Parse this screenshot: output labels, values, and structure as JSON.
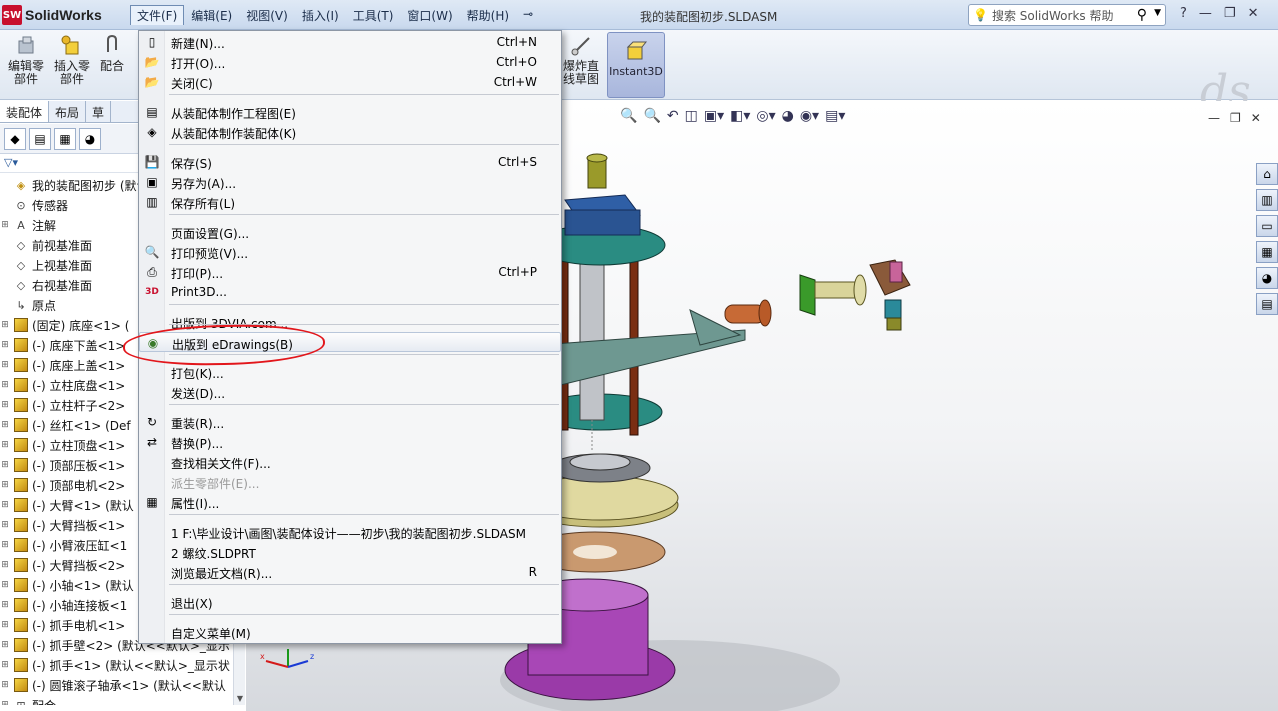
{
  "app": {
    "name": "SolidWorks",
    "logo_mark": "SW",
    "document_title": "我的装配图初步.SLDASM"
  },
  "menubar": [
    "文件(F)",
    "编辑(E)",
    "视图(V)",
    "插入(I)",
    "工具(T)",
    "窗口(W)",
    "帮助(H)"
  ],
  "search": {
    "placeholder": "搜索 SolidWorks 帮助"
  },
  "toolbar": {
    "edit_part": "编辑零\n部件",
    "insert_part": "插入零\n部件",
    "mate": "配合",
    "explode_line": "爆炸直\n线草图",
    "instant3d": "Instant3D"
  },
  "left_tabs": [
    "装配体",
    "布局",
    "草"
  ],
  "tree": [
    {
      "label": "我的装配图初步 (默认",
      "icon": "assembly-icon",
      "exp": ""
    },
    {
      "label": "传感器",
      "icon": "sensor-icon",
      "exp": ""
    },
    {
      "label": "注解",
      "icon": "annotation-icon",
      "exp": "⊞"
    },
    {
      "label": "前视基准面",
      "icon": "plane-icon",
      "exp": ""
    },
    {
      "label": "上视基准面",
      "icon": "plane-icon",
      "exp": ""
    },
    {
      "label": "右视基准面",
      "icon": "plane-icon",
      "exp": ""
    },
    {
      "label": "原点",
      "icon": "origin-icon",
      "exp": ""
    },
    {
      "label": "(固定) 底座<1> (",
      "icon": "part-icon",
      "exp": "⊞"
    },
    {
      "label": "(-) 底座下盖<1>",
      "icon": "part-icon",
      "exp": "⊞"
    },
    {
      "label": "(-) 底座上盖<1>",
      "icon": "part-icon",
      "exp": "⊞"
    },
    {
      "label": "(-) 立柱底盘<1>",
      "icon": "part-icon",
      "exp": "⊞"
    },
    {
      "label": "(-) 立柱杆子<2>",
      "icon": "part-icon",
      "exp": "⊞"
    },
    {
      "label": "(-) 丝杠<1> (Def",
      "icon": "part-icon",
      "exp": "⊞"
    },
    {
      "label": "(-) 立柱顶盘<1>",
      "icon": "part-icon",
      "exp": "⊞"
    },
    {
      "label": "(-) 顶部压板<1>",
      "icon": "part-icon",
      "exp": "⊞"
    },
    {
      "label": "(-) 顶部电机<2>",
      "icon": "part-icon",
      "exp": "⊞"
    },
    {
      "label": "(-) 大臂<1> (默认",
      "icon": "part-icon",
      "exp": "⊞"
    },
    {
      "label": "(-) 大臂挡板<1>",
      "icon": "part-icon",
      "exp": "⊞"
    },
    {
      "label": "(-) 小臂液压缸<1",
      "icon": "part-icon",
      "exp": "⊞"
    },
    {
      "label": "(-) 大臂挡板<2>",
      "icon": "part-icon",
      "exp": "⊞"
    },
    {
      "label": "(-) 小轴<1> (默认",
      "icon": "part-icon",
      "exp": "⊞"
    },
    {
      "label": "(-) 小轴连接板<1",
      "icon": "part-icon",
      "exp": "⊞"
    },
    {
      "label": "(-) 抓手电机<1>",
      "icon": "part-icon",
      "exp": "⊞"
    },
    {
      "label": "(-) 抓手壁<2> (默认<<默认>_显示",
      "icon": "part-icon",
      "exp": "⊞"
    },
    {
      "label": "(-) 抓手<1> (默认<<默认>_显示状",
      "icon": "part-icon",
      "exp": "⊞"
    },
    {
      "label": "(-) 圆锥滚子轴承<1> (默认<<默认",
      "icon": "part-icon",
      "exp": "⊞"
    },
    {
      "label": "配合",
      "icon": "mate-icon",
      "exp": "⊞"
    }
  ],
  "file_menu": {
    "items": [
      {
        "label": "新建(N)...",
        "shortcut": "Ctrl+N",
        "icon": "new-icon"
      },
      {
        "label": "打开(O)...",
        "shortcut": "Ctrl+O",
        "icon": "open-icon"
      },
      {
        "label": "关闭(C)",
        "shortcut": "Ctrl+W",
        "icon": "close-doc-icon"
      },
      {
        "label": "从装配体制作工程图(E)",
        "shortcut": "",
        "icon": "drawing-icon"
      },
      {
        "label": "从装配体制作装配体(K)",
        "shortcut": "",
        "icon": "assembly-icon"
      },
      {
        "label": "保存(S)",
        "shortcut": "Ctrl+S",
        "icon": "save-icon"
      },
      {
        "label": "另存为(A)...",
        "shortcut": "",
        "icon": "save-as-icon"
      },
      {
        "label": "保存所有(L)",
        "shortcut": "",
        "icon": "save-all-icon"
      },
      {
        "label": "页面设置(G)...",
        "shortcut": "",
        "icon": ""
      },
      {
        "label": "打印预览(V)...",
        "shortcut": "",
        "icon": "print-preview-icon"
      },
      {
        "label": "打印(P)...",
        "shortcut": "Ctrl+P",
        "icon": "print-icon"
      },
      {
        "label": "Print3D...",
        "shortcut": "",
        "icon": "print3d-icon"
      },
      {
        "label": "出版到 3DVIA.com...",
        "shortcut": "",
        "icon": ""
      },
      {
        "label": "出版到 eDrawings(B)",
        "shortcut": "",
        "icon": "edrawings-icon"
      },
      {
        "label": "打包(K)...",
        "shortcut": "",
        "icon": ""
      },
      {
        "label": "发送(D)...",
        "shortcut": "",
        "icon": ""
      },
      {
        "label": "重装(R)...",
        "shortcut": "",
        "icon": "reload-icon"
      },
      {
        "label": "替换(P)...",
        "shortcut": "",
        "icon": "replace-icon"
      },
      {
        "label": "查找相关文件(F)...",
        "shortcut": "",
        "icon": ""
      },
      {
        "label": "派生零部件(E)...",
        "shortcut": "",
        "icon": ""
      },
      {
        "label": "属性(I)...",
        "shortcut": "",
        "icon": "properties-icon"
      },
      {
        "label": "1 F:\\毕业设计\\画图\\装配体设计——初步\\我的装配图初步.SLDASM",
        "shortcut": "",
        "icon": ""
      },
      {
        "label": "2 螺纹.SLDPRT",
        "shortcut": "",
        "icon": ""
      },
      {
        "label": "浏览最近文档(R)...",
        "shortcut": "R",
        "icon": ""
      },
      {
        "label": "退出(X)",
        "shortcut": "",
        "icon": ""
      },
      {
        "label": "自定义菜单(M)",
        "shortcut": "",
        "icon": ""
      }
    ],
    "highlighted": "出版到 eDrawings(B)",
    "disabled": "派生零部件(E)..."
  },
  "colors": {
    "accent_red": "#e2161b",
    "menu_highlight": "#e6ebf2"
  }
}
